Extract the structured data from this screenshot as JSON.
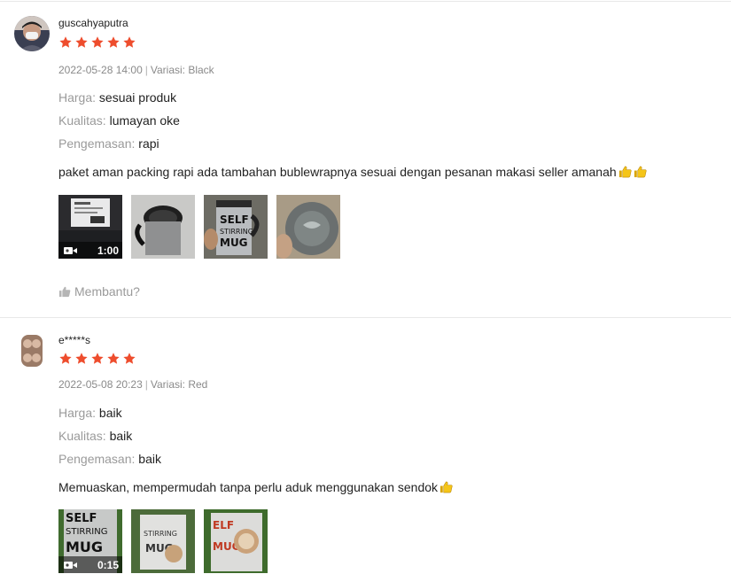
{
  "reviews": [
    {
      "author": "guscahyaputra",
      "rating": 5,
      "date": "2022-05-28 14:00",
      "variant": "Variasi: Black",
      "attrs": [
        {
          "label": "Harga:",
          "value": "sesuai produk"
        },
        {
          "label": "Kualitas:",
          "value": "lumayan oke"
        },
        {
          "label": "Pengemasan:",
          "value": "rapi"
        }
      ],
      "comment": "paket aman packing rapi ada tambahan bublewrapnya sesuai dengan pesanan makasi seller amanah",
      "video_duration": "1:00",
      "media_count": 4
    },
    {
      "author": "e*****s",
      "rating": 5,
      "date": "2022-05-08 20:23",
      "variant": "Variasi: Red",
      "attrs": [
        {
          "label": "Harga:",
          "value": "baik"
        },
        {
          "label": "Kualitas:",
          "value": "baik"
        },
        {
          "label": "Pengemasan:",
          "value": "baik"
        }
      ],
      "comment": "Memuaskan, mempermudah tanpa perlu aduk menggunakan sendok",
      "video_duration": "0:15",
      "media_count": 3
    }
  ],
  "helpful_label": "Membantu?",
  "colors": {
    "star": "#ee4d2d",
    "muted": "#8a8a8a"
  },
  "icons": [
    "star-icon",
    "video-camera-icon",
    "thumbs-up-icon",
    "thumbs-up-emoji"
  ]
}
